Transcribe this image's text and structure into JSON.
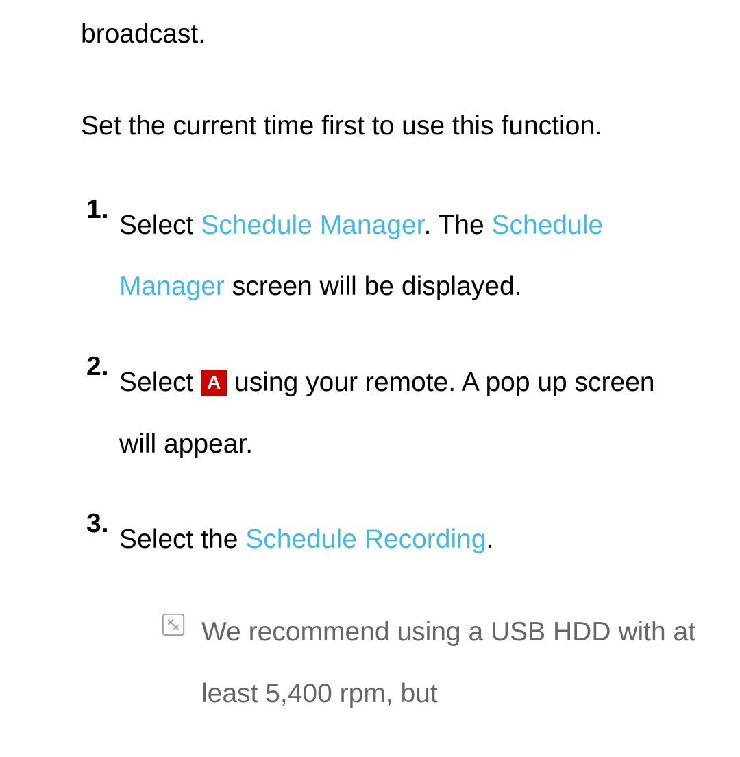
{
  "intro": {
    "line1": "broadcast.",
    "line2": "Set the current time first to use this function."
  },
  "steps": [
    {
      "number": "1.",
      "parts": {
        "t1": "Select ",
        "h1": "Schedule Manager",
        "t2": ". The ",
        "h2": "Schedule Manager",
        "t3": " screen will be displayed."
      }
    },
    {
      "number": "2.",
      "parts": {
        "t1": "Select ",
        "button": "A",
        "t2": " using your remote. A pop up screen will appear."
      }
    },
    {
      "number": "3.",
      "parts": {
        "t1": "Select the ",
        "h1": "Schedule Recording",
        "t2": "."
      }
    }
  ],
  "note": {
    "text": "We recommend using a USB HDD with at least 5,400 rpm, but"
  }
}
